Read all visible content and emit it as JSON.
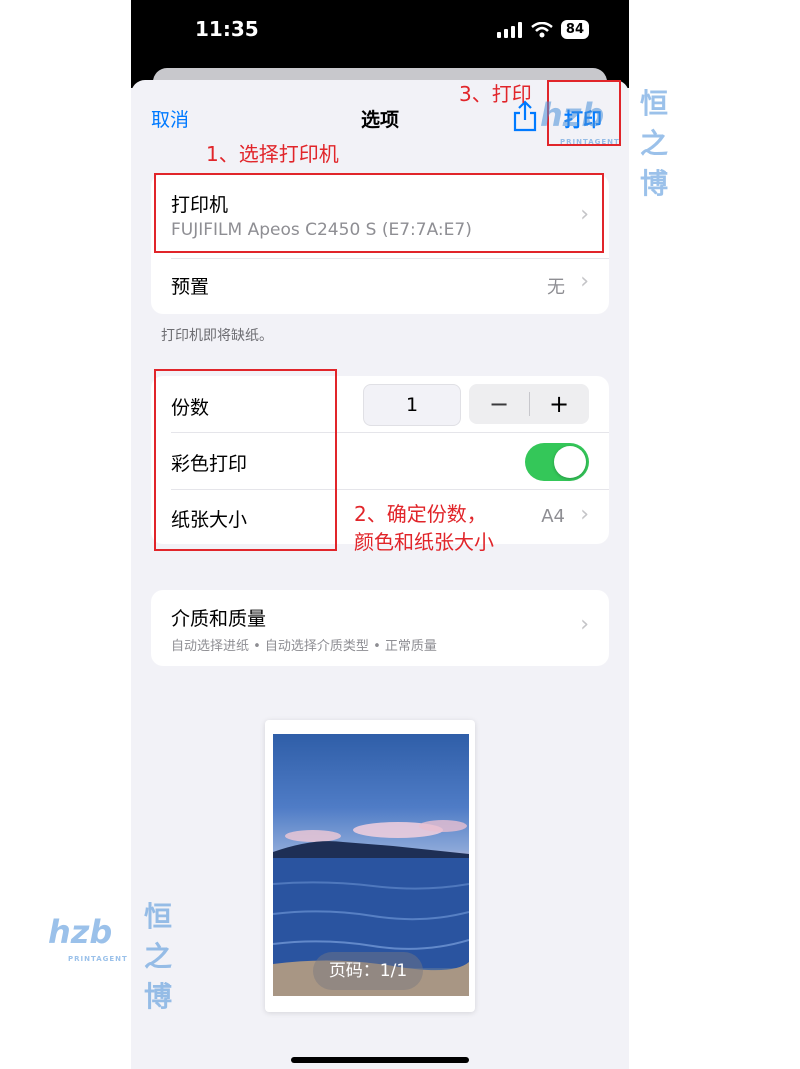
{
  "status_bar": {
    "time": "11:35",
    "battery": "84"
  },
  "nav": {
    "cancel": "取消",
    "title": "选项",
    "print": "打印"
  },
  "printer": {
    "label": "打印机",
    "name": "FUJIFILM Apeos C2450 S (E7:7A:E7)"
  },
  "preset": {
    "label": "预置",
    "value": "无"
  },
  "footnote": "打印机即将缺纸。",
  "copies": {
    "label": "份数",
    "value": "1",
    "minus": "−",
    "plus": "+"
  },
  "color_print": {
    "label": "彩色打印",
    "on": true
  },
  "paper_size": {
    "label": "纸张大小",
    "value": "A4"
  },
  "media": {
    "label": "介质和质量",
    "detail": "自动选择进纸 • 自动选择介质类型 • 正常质量"
  },
  "preview": {
    "page_label": "页码：1/1"
  },
  "annotations": {
    "step1": "1、选择打印机",
    "step2_line1": "2、确定份数，",
    "step2_line2": "颜色和纸张大小",
    "step3": "3、打印"
  },
  "watermark": {
    "logo": "hzb",
    "brand": "恒之博",
    "tagline": "PRINTAGENT"
  },
  "colors": {
    "accent": "#007aff",
    "toggle_on": "#34c759",
    "annotation": "#e1252a",
    "watermark": "#4a90d9"
  }
}
